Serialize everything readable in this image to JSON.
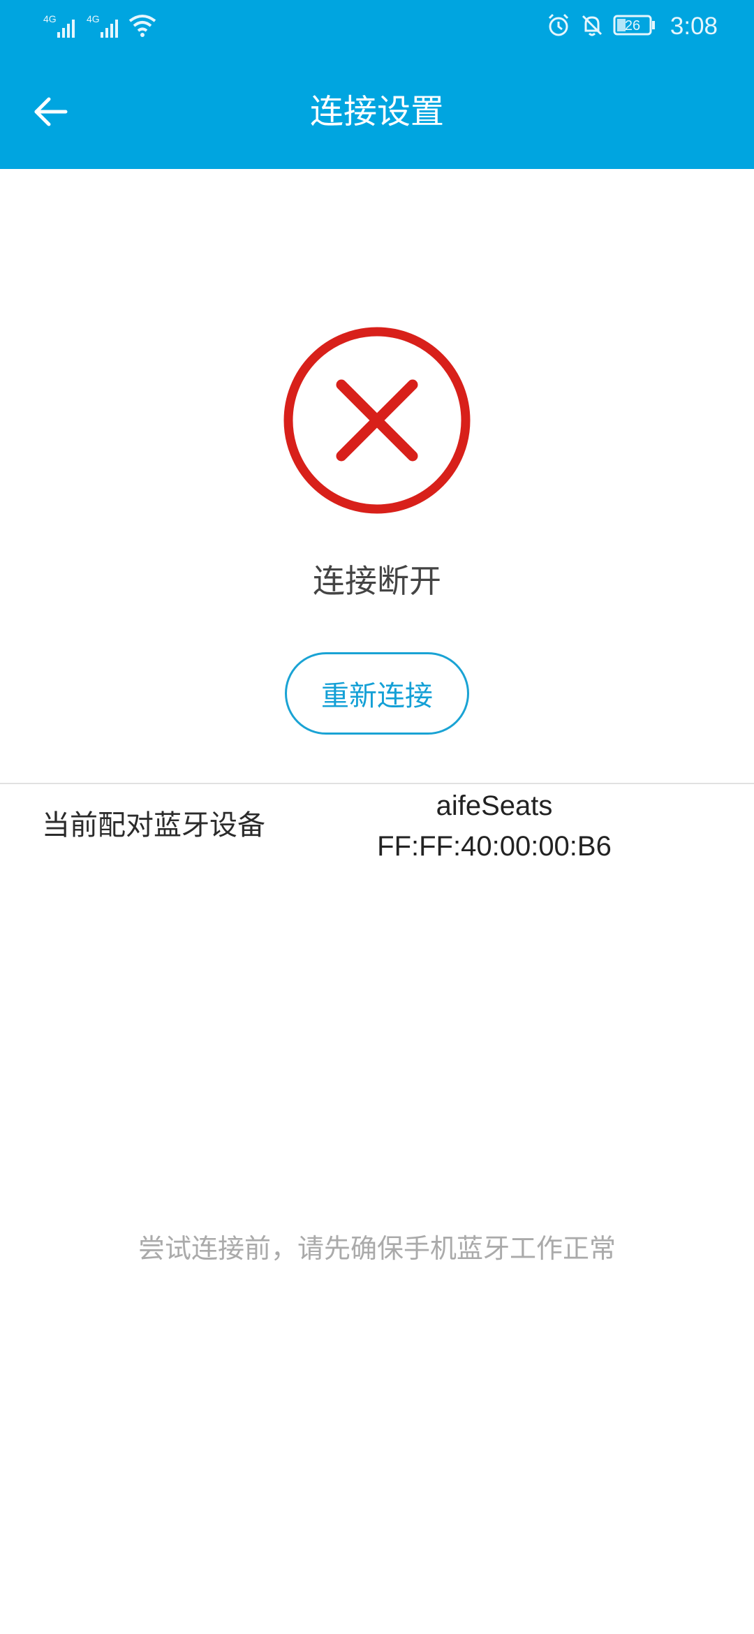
{
  "status_bar": {
    "network1": "4G",
    "network2": "4G",
    "battery": "26",
    "time": "3:08",
    "icons": [
      "signal-icon",
      "signal-icon",
      "wifi-icon",
      "alarm-icon",
      "bell-off-icon",
      "battery-icon"
    ]
  },
  "header": {
    "back_icon": "arrow-left-icon",
    "title": "连接设置",
    "background_color": "#00a5e0"
  },
  "connection": {
    "status_icon": "error-x-icon",
    "status_color": "#d8201a",
    "status_text": "连接断开",
    "reconnect_label": "重新连接",
    "accent_color": "#14a0d6"
  },
  "device": {
    "label": "当前配对蓝牙设备",
    "name": "aifeSeats",
    "mac": "FF:FF:40:00:00:B6"
  },
  "hint": "尝试连接前，请先确保手机蓝牙工作正常"
}
